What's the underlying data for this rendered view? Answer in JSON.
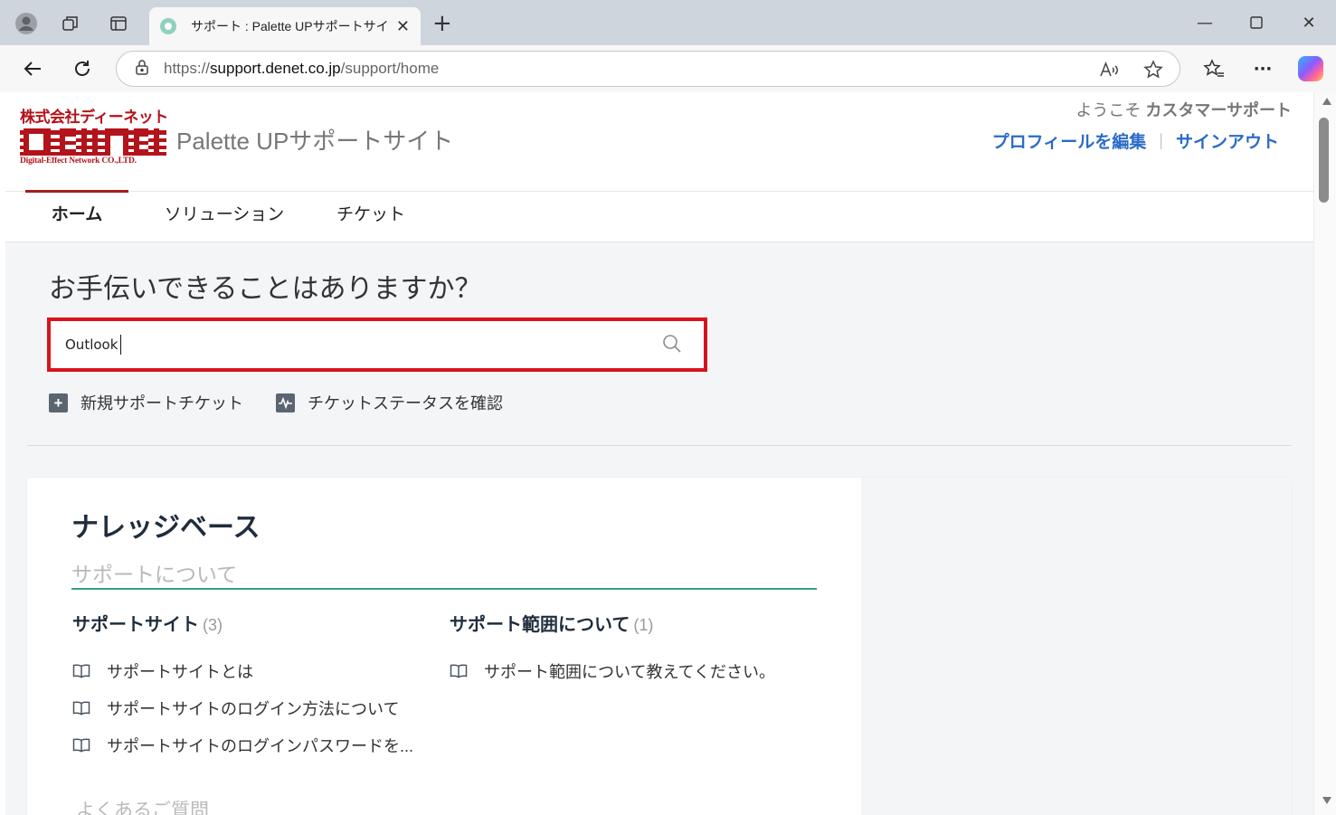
{
  "browser": {
    "tab_title": "サポート : Palette UPサポートサイト",
    "url_scheme": "https://",
    "url_host": "support.denet.co.jp",
    "url_path": "/support/home"
  },
  "header": {
    "logo_top": "株式会社ディーネット",
    "logo_bottom": "Digital-Effect Network CO.,LTD.",
    "site_title": "Palette UPサポートサイト",
    "welcome_prefix": "ようこそ",
    "welcome_name": "カスタマーサポート",
    "edit_profile": "プロフィールを編集",
    "sign_out": "サインアウト"
  },
  "nav": {
    "home": "ホーム",
    "solutions": "ソリューション",
    "tickets": "チケット"
  },
  "hero": {
    "title": "お手伝いできることはありますか？",
    "search_value": "Outlook",
    "new_ticket": "新規サポートチケット",
    "ticket_status": "チケットステータスを確認"
  },
  "knowledge_base": {
    "title": "ナレッジベース",
    "section": "サポートについて",
    "categories": [
      {
        "name": "サポートサイト",
        "count": "(3)",
        "articles": [
          "サポートサイトとは",
          "サポートサイトのログイン方法について",
          "サポートサイトのログインパスワードを..."
        ]
      },
      {
        "name": "サポート範囲について",
        "count": "(1)",
        "articles": [
          "サポート範囲について教えてください。"
        ]
      }
    ],
    "faq": "よくあるご質問"
  },
  "colors": {
    "brand_red": "#b3131b",
    "link_blue": "#2b6bc8",
    "search_highlight": "#d7141d",
    "accent_green": "#3a9e8c"
  }
}
